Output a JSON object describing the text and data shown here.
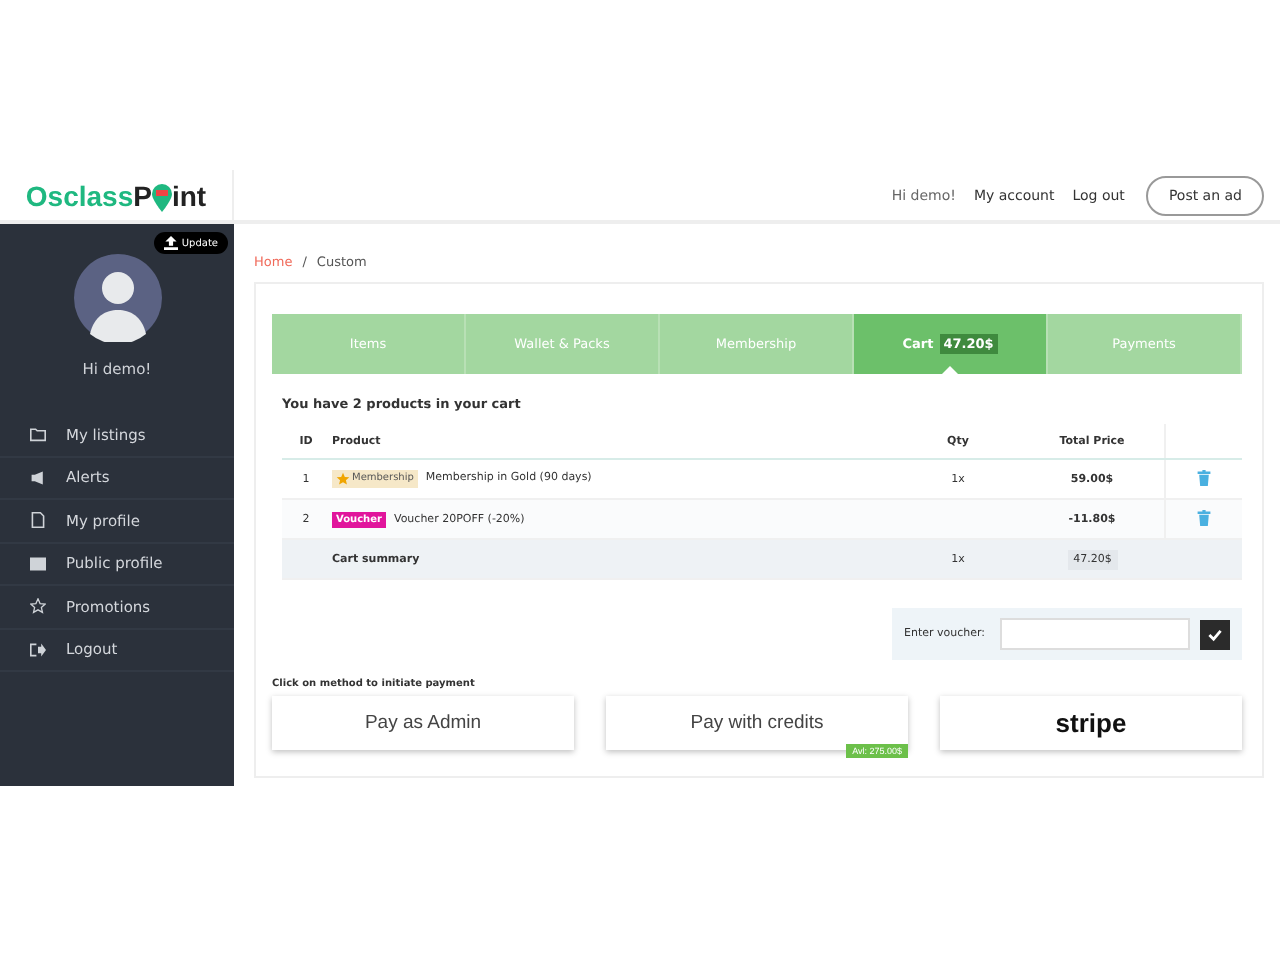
{
  "logo": {
    "brand": "Osclass",
    "part1": "P",
    "part2": "int"
  },
  "header": {
    "greeting": "Hi demo!",
    "links": [
      "My account",
      "Log out"
    ],
    "post_button": "Post an ad"
  },
  "sidebar": {
    "update_button": "Update",
    "greeting": "Hi demo!",
    "items": [
      {
        "label": "My listings",
        "kind": "folder"
      },
      {
        "label": "Alerts",
        "kind": "megaphone"
      },
      {
        "label": "My profile",
        "kind": "file"
      },
      {
        "label": "Public profile",
        "kind": "image"
      },
      {
        "label": "Promotions",
        "kind": "star"
      },
      {
        "label": "Logout",
        "kind": "exit"
      }
    ]
  },
  "breadcrumb": {
    "home": "Home",
    "separator": "/",
    "current": "Custom"
  },
  "tabs": [
    {
      "label": "Items",
      "selected": false
    },
    {
      "label": "Wallet & Packs",
      "selected": false
    },
    {
      "label": "Membership",
      "selected": false
    },
    {
      "label": "Cart",
      "badge": "47.20$",
      "selected": true
    },
    {
      "label": "Payments",
      "selected": false
    }
  ],
  "cart": {
    "title": "You have 2 products in your cart",
    "columns": [
      "ID",
      "Product",
      "Qty",
      "Total Price"
    ],
    "rows": [
      {
        "id": "1",
        "tag": "Membership",
        "kind": "membership",
        "product": "Membership in Gold (90 days)",
        "qty": "1x",
        "price": "59.00$"
      },
      {
        "id": "2",
        "tag": "Voucher",
        "kind": "voucher",
        "product": "Voucher 20POFF (-20%)",
        "price": "-11.80$"
      }
    ],
    "summary": {
      "label": "Cart summary",
      "qty": "1x",
      "price": "47.20$"
    }
  },
  "voucher": {
    "label": "Enter voucher:"
  },
  "payment": {
    "hint": "Click on method to initiate payment",
    "methods": [
      {
        "kind": "text",
        "label": "Pay as Admin"
      },
      {
        "kind": "text",
        "label": "Pay with credits",
        "badge": "Avl: 275.00$"
      },
      {
        "kind": "logo",
        "label": "stripe"
      }
    ]
  }
}
